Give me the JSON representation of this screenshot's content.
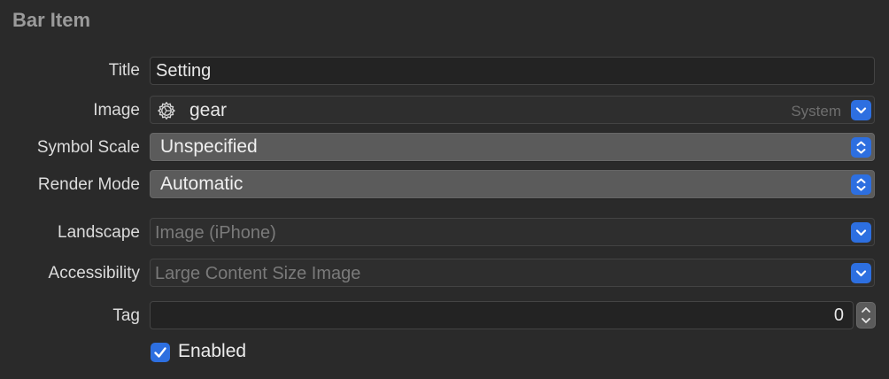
{
  "section": {
    "title": "Bar Item"
  },
  "title_row": {
    "label": "Title",
    "value": "Setting"
  },
  "image_row": {
    "label": "Image",
    "value": "gear",
    "icon": "gear-icon",
    "hint": "System"
  },
  "symbol_scale_row": {
    "label": "Symbol Scale",
    "value": "Unspecified"
  },
  "render_mode_row": {
    "label": "Render Mode",
    "value": "Automatic"
  },
  "landscape_row": {
    "label": "Landscape",
    "placeholder": "Image (iPhone)"
  },
  "accessibility_row": {
    "label": "Accessibility",
    "placeholder": "Large Content Size Image"
  },
  "tag_row": {
    "label": "Tag",
    "value": "0"
  },
  "enabled": {
    "label": "Enabled",
    "checked": true
  },
  "colors": {
    "accent": "#2d6fe0",
    "background": "#2a2a2a"
  }
}
